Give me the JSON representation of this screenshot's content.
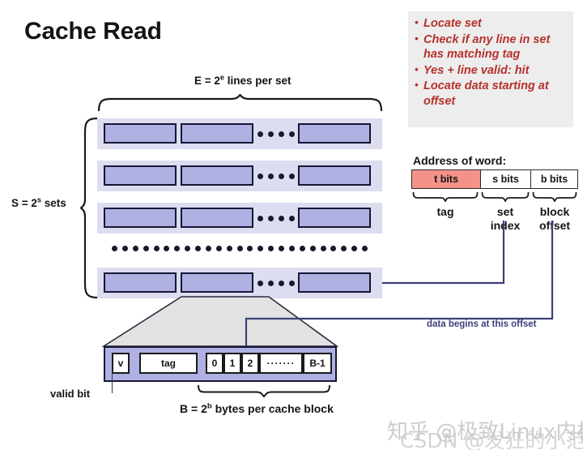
{
  "title": "Cache Read",
  "callout": {
    "items": [
      "Locate set",
      "Check if any line in set has matching tag",
      "Yes + line valid: hit",
      "Locate data starting at offset"
    ],
    "bg_color": "#ededed",
    "text_color": "#b7312c"
  },
  "cache": {
    "lines_label_prefix": "E = 2",
    "lines_label_exp": "e",
    "lines_label_suffix": " lines per set",
    "sets_label_prefix": "S = 2",
    "sets_label_exp": "s",
    "sets_label_suffix": " sets",
    "row_count": 4,
    "lines_per_row_visible": 3,
    "inner_dots_per_row": 4,
    "set_ellipsis_dots": 25,
    "row_bg_color": "#dcddf0",
    "line_fill_color": "#aeb1e2",
    "line_border_color": "#161636"
  },
  "address": {
    "title": "Address of word:",
    "fields": [
      {
        "label": "t bits",
        "color": "#f49289"
      },
      {
        "label": "s bits",
        "color": "#ffffff"
      },
      {
        "label": "b bits",
        "color": "#ffffff"
      }
    ],
    "captions": [
      "tag",
      "set index",
      "block offset"
    ],
    "caption_tag": "tag",
    "caption_set": "set\nindex",
    "caption_set_line1": "set",
    "caption_set_line2": "index",
    "caption_block_line1": "block",
    "caption_block_line2": "offset"
  },
  "connectors": {
    "offset_note": "data begins at this offset",
    "line_color": "#3b4079"
  },
  "block": {
    "valid_cell": "v",
    "tag_cell": "tag",
    "byte_cells": [
      "0",
      "1",
      "2"
    ],
    "ellipsis_cell": "·······",
    "last_cell": "B-1",
    "valid_label": "valid bit",
    "bytes_label_prefix": "B = 2",
    "bytes_label_exp": "b",
    "bytes_label_suffix": " bytes per cache block",
    "tag_color": "#f49289",
    "body_color": "#aeb1e2"
  },
  "watermarks": {
    "zhihu": "知乎 @极致Linux内核",
    "csdn": "CSDN @发狂的小范"
  }
}
